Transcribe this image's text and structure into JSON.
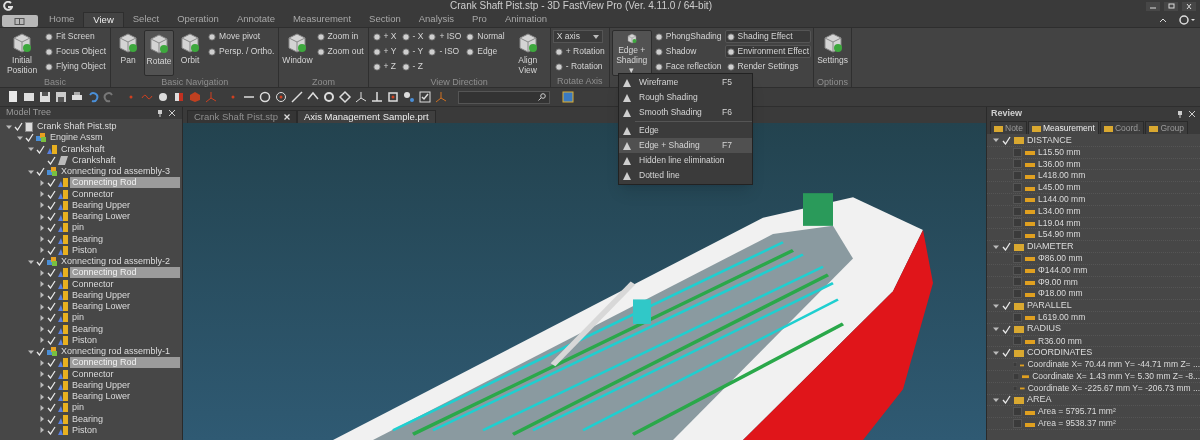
{
  "window": {
    "title": "Crank Shaft Pist.stp - 3D FastView Pro (Ver. 4.11.0 / 64-bit)"
  },
  "ribbon_tabs": [
    {
      "label": "Home",
      "selected": false
    },
    {
      "label": "View",
      "selected": true
    },
    {
      "label": "Select",
      "selected": false
    },
    {
      "label": "Operation",
      "selected": false
    },
    {
      "label": "Annotate",
      "selected": false
    },
    {
      "label": "Measurement",
      "selected": false
    },
    {
      "label": "Section",
      "selected": false
    },
    {
      "label": "Analysis",
      "selected": false
    },
    {
      "label": "Pro",
      "selected": false
    },
    {
      "label": "Animation",
      "selected": false
    }
  ],
  "ribbon_groups": [
    {
      "label": "Basic",
      "items": [
        {
          "kind": "large",
          "label": "Initial Position",
          "selected": false
        },
        {
          "kind": "small",
          "label": "Fit Screen",
          "selected": false
        },
        {
          "kind": "small",
          "label": "Focus Object",
          "selected": false
        },
        {
          "kind": "small",
          "label": "Flying Object",
          "selected": false
        }
      ]
    },
    {
      "label": "Basic Navigation",
      "items": [
        {
          "kind": "large",
          "label": "Pan",
          "selected": false
        },
        {
          "kind": "large",
          "label": "Rotate",
          "selected": true
        },
        {
          "kind": "large",
          "label": "Orbit",
          "selected": false
        },
        {
          "kind": "small",
          "label": "Move pivot",
          "selected": false
        },
        {
          "kind": "small",
          "label": "Persp. / Ortho.",
          "selected": false
        }
      ]
    },
    {
      "label": "Zoom",
      "items": [
        {
          "kind": "large",
          "label": "Window",
          "selected": false
        },
        {
          "kind": "small",
          "label": "Zoom in",
          "selected": false
        },
        {
          "kind": "small",
          "label": "Zoom out",
          "selected": false
        }
      ]
    },
    {
      "label": "View Direction",
      "items": [
        {
          "kind": "small",
          "label": "+ X",
          "selected": false
        },
        {
          "kind": "small",
          "label": "+ Y",
          "selected": false
        },
        {
          "kind": "small",
          "label": "+ Z",
          "selected": false
        },
        {
          "kind": "small",
          "label": "- X",
          "selected": false
        },
        {
          "kind": "small",
          "label": "- Y",
          "selected": false
        },
        {
          "kind": "small",
          "label": "- Z",
          "selected": false
        },
        {
          "kind": "small",
          "label": "+ ISO",
          "selected": false
        },
        {
          "kind": "small",
          "label": "- ISO",
          "selected": false
        },
        {
          "kind": "break"
        },
        {
          "kind": "small",
          "label": "Normal",
          "selected": false
        },
        {
          "kind": "small",
          "label": "Edge",
          "selected": false
        },
        {
          "kind": "large",
          "label": "Align View",
          "selected": false
        }
      ]
    },
    {
      "label": "Rotate Axis",
      "items": [
        {
          "kind": "dropdown",
          "label": "X axis"
        },
        {
          "kind": "small",
          "label": "+ Rotation",
          "selected": false
        },
        {
          "kind": "small",
          "label": "- Rotation",
          "selected": false
        }
      ]
    },
    {
      "items": [
        {
          "kind": "large",
          "label": "Edge + Shading ▾",
          "selected": true
        },
        {
          "kind": "small",
          "label": "PhongShading",
          "selected": false
        },
        {
          "kind": "small",
          "label": "Shadow",
          "selected": false
        },
        {
          "kind": "small",
          "label": "Face reflection",
          "selected": false
        },
        {
          "kind": "small",
          "label": "Shading Effect",
          "selected": true
        },
        {
          "kind": "small",
          "label": "Environment Effect",
          "selected": true
        },
        {
          "kind": "small",
          "label": "Render Settings",
          "selected": false
        }
      ]
    },
    {
      "label": "Options",
      "items": [
        {
          "kind": "large",
          "label": "Settings",
          "selected": false
        }
      ]
    }
  ],
  "model_tree": {
    "title": "Model Tree",
    "items": [
      {
        "label": "Crank Shaft Pist.stp",
        "kind": "file",
        "checked": true,
        "selected": false,
        "expanded": true,
        "children": [
          {
            "label": "Engine Assm",
            "kind": "assembly",
            "checked": true,
            "selected": false,
            "expanded": true,
            "children": [
              {
                "label": "Crankshaft",
                "kind": "part",
                "checked": true,
                "selected": false,
                "expanded": true,
                "children": [
                  {
                    "label": "Crankshaft",
                    "kind": "body",
                    "checked": true,
                    "selected": false
                  }
                ]
              },
              {
                "label": "Xonnecting rod assembly-3",
                "kind": "assembly",
                "checked": true,
                "selected": false,
                "expanded": true,
                "children": [
                  {
                    "label": "Connecting Rod",
                    "kind": "part",
                    "checked": true,
                    "selected": true,
                    "expanded": false
                  },
                  {
                    "label": "Connector",
                    "kind": "part",
                    "checked": true,
                    "selected": false,
                    "expanded": false
                  },
                  {
                    "label": "Bearing Upper",
                    "kind": "part",
                    "checked": true,
                    "selected": false,
                    "expanded": false
                  },
                  {
                    "label": "Bearing Lower",
                    "kind": "part",
                    "checked": true,
                    "selected": false,
                    "expanded": false
                  },
                  {
                    "label": "pin",
                    "kind": "part",
                    "checked": true,
                    "selected": false,
                    "expanded": false
                  },
                  {
                    "label": "Bearing",
                    "kind": "part",
                    "checked": true,
                    "selected": false,
                    "expanded": false
                  },
                  {
                    "label": "Piston",
                    "kind": "part",
                    "checked": true,
                    "selected": false,
                    "expanded": false
                  }
                ]
              },
              {
                "label": "Xonnecting rod assembly-2",
                "kind": "assembly",
                "checked": true,
                "selected": false,
                "expanded": true,
                "children": [
                  {
                    "label": "Connecting Rod",
                    "kind": "part",
                    "checked": true,
                    "selected": true,
                    "expanded": false
                  },
                  {
                    "label": "Connector",
                    "kind": "part",
                    "checked": true,
                    "selected": false,
                    "expanded": false
                  },
                  {
                    "label": "Bearing Upper",
                    "kind": "part",
                    "checked": true,
                    "selected": false,
                    "expanded": false
                  },
                  {
                    "label": "Bearing Lower",
                    "kind": "part",
                    "checked": true,
                    "selected": false,
                    "expanded": false
                  },
                  {
                    "label": "pin",
                    "kind": "part",
                    "checked": true,
                    "selected": false,
                    "expanded": false
                  },
                  {
                    "label": "Bearing",
                    "kind": "part",
                    "checked": true,
                    "selected": false,
                    "expanded": false
                  },
                  {
                    "label": "Piston",
                    "kind": "part",
                    "checked": true,
                    "selected": false,
                    "expanded": false
                  }
                ]
              },
              {
                "label": "Xonnecting rod assembly-1",
                "kind": "assembly",
                "checked": true,
                "selected": false,
                "expanded": true,
                "children": [
                  {
                    "label": "Connecting Rod",
                    "kind": "part",
                    "checked": true,
                    "selected": true,
                    "expanded": false
                  },
                  {
                    "label": "Connector",
                    "kind": "part",
                    "checked": true,
                    "selected": false,
                    "expanded": false
                  },
                  {
                    "label": "Bearing Upper",
                    "kind": "part",
                    "checked": true,
                    "selected": false,
                    "expanded": false
                  },
                  {
                    "label": "Bearing Lower",
                    "kind": "part",
                    "checked": true,
                    "selected": false,
                    "expanded": false
                  },
                  {
                    "label": "pin",
                    "kind": "part",
                    "checked": true,
                    "selected": false,
                    "expanded": false
                  },
                  {
                    "label": "Bearing",
                    "kind": "part",
                    "checked": true,
                    "selected": false,
                    "expanded": false
                  },
                  {
                    "label": "Piston",
                    "kind": "part",
                    "checked": true,
                    "selected": false,
                    "expanded": false
                  }
                ]
              }
            ]
          }
        ]
      }
    ]
  },
  "document_tabs": [
    {
      "label": "Crank Shaft Pist.stp",
      "selected": false
    },
    {
      "label": "Axis Management Sample.prt",
      "selected": true
    }
  ],
  "shading_menu": {
    "items": [
      {
        "kind": "item",
        "label": "Wireframe",
        "shortcut": "F5",
        "selected": false
      },
      {
        "kind": "item",
        "label": "Rough Shading",
        "selected": false
      },
      {
        "kind": "item",
        "label": "Smooth Shading",
        "shortcut": "F6",
        "selected": false
      },
      {
        "kind": "separator"
      },
      {
        "kind": "item",
        "label": "Edge",
        "selected": false
      },
      {
        "kind": "item",
        "label": "Edge + Shading",
        "shortcut": "F7",
        "selected": true
      },
      {
        "kind": "item",
        "label": "Hidden line elimination",
        "selected": false
      },
      {
        "kind": "item",
        "label": "Dotted line",
        "selected": false
      }
    ]
  },
  "review": {
    "title": "Review",
    "tabs": [
      {
        "label": "Note",
        "selected": false
      },
      {
        "label": "Measurement",
        "selected": true
      },
      {
        "label": "Coord.",
        "selected": false
      },
      {
        "label": "Group",
        "selected": false
      }
    ],
    "categories": [
      {
        "label": "DISTANCE",
        "checked": true,
        "expanded": true,
        "items": [
          {
            "label": "L15.50 mm",
            "checked": false
          },
          {
            "label": "L36.00 mm",
            "checked": false
          },
          {
            "label": "L418.00 mm",
            "checked": false
          },
          {
            "label": "L45.00 mm",
            "checked": false
          },
          {
            "label": "L144.00 mm",
            "checked": false
          },
          {
            "label": "L34.00 mm",
            "checked": false
          },
          {
            "label": "L19.04 mm",
            "checked": false
          },
          {
            "label": "L54.90 mm",
            "checked": false
          }
        ]
      },
      {
        "label": "DIAMETER",
        "checked": true,
        "expanded": true,
        "items": [
          {
            "label": "Φ86.00 mm",
            "checked": false
          },
          {
            "label": "Φ144.00 mm",
            "checked": false
          },
          {
            "label": "Φ9.00 mm",
            "checked": false
          },
          {
            "label": "Φ18.00 mm",
            "checked": false
          }
        ]
      },
      {
        "label": "PARALLEL",
        "checked": true,
        "expanded": true,
        "items": [
          {
            "label": "L619.00 mm",
            "checked": false
          }
        ]
      },
      {
        "label": "RADIUS",
        "checked": true,
        "expanded": true,
        "items": [
          {
            "label": "R36.00 mm",
            "checked": false
          }
        ]
      },
      {
        "label": "COORDINATES",
        "checked": true,
        "expanded": true,
        "items": [
          {
            "label": "Coordinate  X= 70.44 mm  Y= -44.71 mm  Z= ...",
            "checked": false
          },
          {
            "label": "Coordinate  X= 1.43 mm  Y= 5.30 mm  Z= -8...",
            "checked": false
          },
          {
            "label": "Coordinate  X= -225.67 mm  Y= -206.73 mm  ...",
            "checked": false
          }
        ]
      },
      {
        "label": "AREA",
        "checked": true,
        "expanded": true,
        "items": [
          {
            "label": "Area = 5795.71 mm²",
            "checked": false
          },
          {
            "label": "Area = 9538.37 mm²",
            "checked": false
          }
        ]
      }
    ]
  }
}
